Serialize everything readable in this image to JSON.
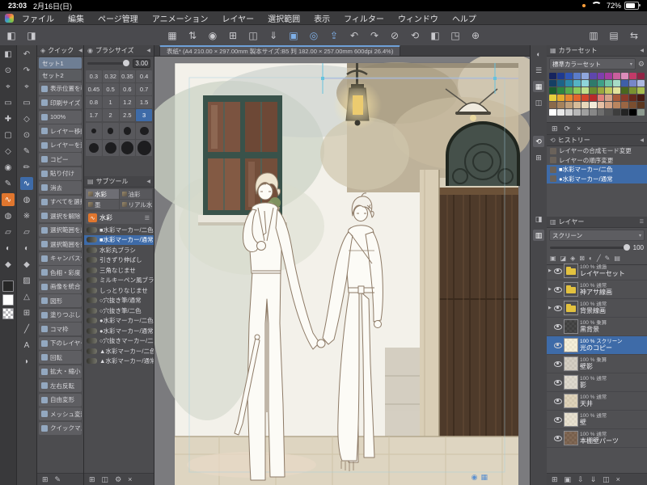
{
  "glyphs": {
    "collapse": "◀",
    "burger": "☰",
    "dropdown": "▾",
    "gear": "⚙"
  },
  "status_bar": {
    "time": "23:03",
    "date": "2月16日(日)",
    "battery_percent": "72%"
  },
  "menu_bar": {
    "items": [
      "ファイル",
      "編集",
      "ページ管理",
      "アニメーション",
      "レイヤー",
      "選択範囲",
      "表示",
      "フィルター",
      "ウィンドウ",
      "ヘルプ"
    ]
  },
  "toolbar": {
    "left_icons": [
      {
        "name": "tool-panel-toggle-icon",
        "glyph": "◧"
      },
      {
        "name": "quick-panel-toggle-icon",
        "glyph": "◨"
      }
    ],
    "center_icons": [
      {
        "name": "workspace-grid-icon",
        "glyph": "▦",
        "cls": ""
      },
      {
        "name": "panel-arrange-icon",
        "glyph": "⇅",
        "cls": ""
      },
      {
        "name": "clip-studio-logo-icon",
        "glyph": "◉",
        "cls": ""
      },
      {
        "name": "new-canvas-icon",
        "glyph": "⊞",
        "cls": ""
      },
      {
        "name": "page-manager-icon",
        "glyph": "◫",
        "cls": ""
      },
      {
        "name": "import-icon",
        "glyph": "⇓",
        "cls": ""
      },
      {
        "name": "photo-library-icon",
        "glyph": "▣",
        "cls": "accent"
      },
      {
        "name": "camera-icon",
        "glyph": "◎",
        "cls": "accent"
      },
      {
        "name": "share-icon",
        "glyph": "⇪",
        "cls": "accent"
      },
      {
        "name": "undo-icon",
        "glyph": "↶",
        "cls": ""
      },
      {
        "name": "redo-icon",
        "glyph": "↷",
        "cls": ""
      },
      {
        "name": "deselect-icon",
        "glyph": "⊘",
        "cls": ""
      },
      {
        "name": "rotate-canvas-icon",
        "glyph": "⟲",
        "cls": ""
      },
      {
        "name": "flip-canvas-icon",
        "glyph": "◧",
        "cls": ""
      },
      {
        "name": "fit-screen-icon",
        "glyph": "◳",
        "cls": ""
      },
      {
        "name": "zoom-in-icon",
        "glyph": "⊕",
        "cls": ""
      }
    ],
    "right_icons": [
      {
        "name": "color-panel-toggle-icon",
        "glyph": "▥"
      },
      {
        "name": "layer-panel-toggle-icon",
        "glyph": "▤"
      },
      {
        "name": "workspace-switch-icon",
        "glyph": "⇆"
      }
    ]
  },
  "document_tab": {
    "title": "表紙* (A4 210.00 × 297.00mm 製本サイズ:B5 判 182.00 × 257.00mm 600dpi 26.4%)"
  },
  "tool_strip_a": {
    "main_color": "#262626",
    "sub_color": "#ffffff",
    "items": [
      {
        "name": "collapse-tools-icon",
        "glyph": "◧",
        "state": ""
      },
      {
        "name": "zoom-tool",
        "glyph": "⊙",
        "state": ""
      },
      {
        "name": "move-canvas-tool",
        "glyph": "⌖",
        "state": ""
      },
      {
        "name": "operation-tool",
        "glyph": "▭",
        "state": ""
      },
      {
        "name": "layer-move-tool",
        "glyph": "✚",
        "state": ""
      },
      {
        "name": "selection-tool",
        "glyph": "▢",
        "state": ""
      },
      {
        "name": "auto-select-tool",
        "glyph": "◇",
        "state": ""
      },
      {
        "name": "eyedropper-tool",
        "glyph": "◉",
        "state": ""
      },
      {
        "name": "pen-tool",
        "glyph": "✎",
        "state": ""
      },
      {
        "name": "brush-tool",
        "glyph": "∿",
        "state": "selected"
      },
      {
        "name": "airbrush-tool",
        "glyph": "◍",
        "state": ""
      },
      {
        "name": "eraser-tool",
        "glyph": "▱",
        "state": ""
      },
      {
        "name": "blend-tool",
        "glyph": "◐",
        "state": ""
      },
      {
        "name": "fill-tool",
        "glyph": "◆",
        "state": ""
      }
    ]
  },
  "tool_strip_b": {
    "items": [
      {
        "name": "undo-tool-icon",
        "glyph": "↶",
        "state": ""
      },
      {
        "name": "redo-tool-icon",
        "glyph": "↷",
        "state": ""
      },
      {
        "name": "operation-sub-tool",
        "glyph": "⌖",
        "state": ""
      },
      {
        "name": "selection-sub-tool",
        "glyph": "▭",
        "state": ""
      },
      {
        "name": "auto-select-sub-tool",
        "glyph": "◇",
        "state": ""
      },
      {
        "name": "eyedropper-sub-tool",
        "glyph": "⊙",
        "state": ""
      },
      {
        "name": "pen-sub-tool",
        "glyph": "✎",
        "state": ""
      },
      {
        "name": "pencil-sub-tool",
        "glyph": "✏",
        "state": ""
      },
      {
        "name": "brush-sub-tool",
        "glyph": "∿",
        "state": "selected"
      },
      {
        "name": "airbrush-sub-tool",
        "glyph": "◍",
        "state": ""
      },
      {
        "name": "decoration-sub-tool",
        "glyph": "※",
        "state": ""
      },
      {
        "name": "eraser-sub-tool",
        "glyph": "▱",
        "state": ""
      },
      {
        "name": "blend-sub-tool",
        "glyph": "◐",
        "state": ""
      },
      {
        "name": "fill-sub-tool",
        "glyph": "◆",
        "state": ""
      },
      {
        "name": "gradient-sub-tool",
        "glyph": "▨",
        "state": ""
      },
      {
        "name": "figure-sub-tool",
        "glyph": "△",
        "state": ""
      },
      {
        "name": "frame-border-sub-tool",
        "glyph": "⊞",
        "state": ""
      },
      {
        "name": "ruler-sub-tool",
        "glyph": "╱",
        "state": ""
      },
      {
        "name": "text-sub-tool",
        "glyph": "A",
        "state": ""
      },
      {
        "name": "balloon-sub-tool",
        "glyph": "◗",
        "state": ""
      }
    ]
  },
  "quick_panel": {
    "title": "クイック",
    "icon_glyph": "◈",
    "sets": [
      {
        "label": "セット1",
        "state": "selected"
      },
      {
        "label": "セット2",
        "state": ""
      }
    ],
    "items": [
      "表示位置を移動",
      "印刷サイズ",
      "100%",
      "レイヤー移動",
      "レイヤーを選択",
      "コピー",
      "貼り付け",
      "消去",
      "すべてを選択",
      "選択を解除",
      "選択範囲を反転",
      "選択範囲を拡張",
      "キャンバスサイズ",
      "色相・彩度・明度",
      "画像を統合",
      "図形",
      "塗りつぶし",
      "コマ枠",
      "下のレイヤーに結合",
      "回転",
      "拡大・縮小",
      "左右反転",
      "自由変形",
      "メッシュ変形",
      "クイックマスク"
    ],
    "footer_icons": [
      {
        "name": "add-quick-item-icon",
        "glyph": "⊞"
      },
      {
        "name": "edit-quick-item-icon",
        "glyph": "✎"
      }
    ]
  },
  "brush_size_panel": {
    "title": "ブラシサイズ",
    "icon_glyph": "◉",
    "current_value": "3.00",
    "sizes": [
      {
        "label": "0.3",
        "state": ""
      },
      {
        "label": "0.32",
        "state": ""
      },
      {
        "label": "0.35",
        "state": ""
      },
      {
        "label": "0.4",
        "state": ""
      },
      {
        "label": "0.45",
        "state": ""
      },
      {
        "label": "0.5",
        "state": ""
      },
      {
        "label": "0.6",
        "state": ""
      },
      {
        "label": "0.7",
        "state": ""
      },
      {
        "label": "0.8",
        "state": ""
      },
      {
        "label": "1",
        "state": ""
      },
      {
        "label": "1.2",
        "state": ""
      },
      {
        "label": "1.5",
        "state": ""
      },
      {
        "label": "1.7",
        "state": ""
      },
      {
        "label": "2",
        "state": ""
      },
      {
        "label": "2.5",
        "state": ""
      },
      {
        "label": "3",
        "state": "selected"
      }
    ],
    "dot_count": 8
  },
  "subtool_panel": {
    "title": "サブツール",
    "icon_glyph": "▤",
    "tabs": [
      {
        "label": "水彩",
        "state": "selected"
      },
      {
        "label": "油彩",
        "state": ""
      },
      {
        "label": "墨",
        "state": ""
      },
      {
        "label": "リアル水彩",
        "state": ""
      }
    ],
    "current_tool_label": "水彩",
    "current_tool_icon_glyph": "∿",
    "items": [
      {
        "label": "■水彩マーカー/二色",
        "state": ""
      },
      {
        "label": "■水彩マーカー/通常",
        "state": "selected"
      },
      {
        "label": "水彩丸ブラシ",
        "state": ""
      },
      {
        "label": "引きずり伸ばし",
        "state": ""
      },
      {
        "label": "三角なじませ",
        "state": ""
      },
      {
        "label": "ミルキーペン風ブラシ",
        "state": ""
      },
      {
        "label": "しっとりなじませ",
        "state": ""
      },
      {
        "label": "○穴抜き筆/通常",
        "state": ""
      },
      {
        "label": "○穴抜き筆/二色",
        "state": ""
      },
      {
        "label": "●水彩マーカー/二色",
        "state": ""
      },
      {
        "label": "●水彩マーカー/通常",
        "state": ""
      },
      {
        "label": "○穴抜きマーカー/二色",
        "state": ""
      },
      {
        "label": "▲水彩マーカー/二色",
        "state": ""
      },
      {
        "label": "▲水彩マーカー/通常",
        "state": ""
      }
    ],
    "footer_icons": [
      {
        "name": "add-subtool-icon",
        "glyph": "⊞"
      },
      {
        "name": "duplicate-subtool-icon",
        "glyph": "◫"
      },
      {
        "name": "subtool-settings-icon",
        "glyph": "⚙"
      },
      {
        "name": "delete-subtool-icon",
        "glyph": "×"
      }
    ]
  },
  "color_set_panel": {
    "title": "カラーセット",
    "icon_glyph": "▦",
    "dropdown_value": "標準カラーセット",
    "selected_index": 60,
    "swatches": [
      "#16245e",
      "#1f3a8f",
      "#2f55b5",
      "#5b7cc9",
      "#8fa6dc",
      "#5e47ad",
      "#7e3fae",
      "#a63ca0",
      "#c95f9d",
      "#dd8cba",
      "#c23a68",
      "#8f2445",
      "#153f63",
      "#1d6387",
      "#2d8aa8",
      "#55b3c4",
      "#8fd4da",
      "#2f7a6b",
      "#3fa087",
      "#70c2a4",
      "#a7dcc6",
      "#3f5fa8",
      "#7787c9",
      "#adb8e0",
      "#1d5c2d",
      "#2f8540",
      "#58aa4e",
      "#8cc95e",
      "#bfdf8c",
      "#6a8c2f",
      "#9aa83f",
      "#c2c95e",
      "#e2e39c",
      "#49681f",
      "#7a9230",
      "#a9bd50",
      "#e5cf3d",
      "#e5ab2e",
      "#e5862e",
      "#e2652c",
      "#d2452c",
      "#b82a2a",
      "#e07f78",
      "#d4a188",
      "#a85a3a",
      "#8a3a2a",
      "#67291c",
      "#471b13",
      "#8a6a4a",
      "#a5825c",
      "#bf9f7a",
      "#d6bc99",
      "#e8d8ba",
      "#f2ead8",
      "#e5c0a5",
      "#d2a183",
      "#b9855f",
      "#9a6644",
      "#7a4e30",
      "#5a3720",
      "#ffffff",
      "#e8e8e8",
      "#d0d0d0",
      "#b8b8b8",
      "#9f9f9f",
      "#878787",
      "#6e6e6e",
      "#555555",
      "#3d3d3d",
      "#242424",
      "#000000",
      "#8d9a90"
    ],
    "footer_icons": [
      {
        "name": "add-color-icon",
        "glyph": "⊞"
      },
      {
        "name": "replace-color-icon",
        "glyph": "⟳"
      },
      {
        "name": "delete-color-icon",
        "glyph": "×"
      }
    ]
  },
  "history_panel": {
    "title": "ヒストリー",
    "icon_glyph": "⟲",
    "items": [
      {
        "label": "レイヤーの合成モード変更",
        "state": ""
      },
      {
        "label": "レイヤーの順序変更",
        "state": ""
      },
      {
        "label": "■水彩マーカー/二色",
        "state": "selected"
      },
      {
        "label": "●水彩マーカー/通常",
        "state": "selected"
      }
    ]
  },
  "layer_panel": {
    "title": "レイヤー",
    "icon_glyph": "▥",
    "blend_mode": "スクリーン",
    "opacity_value": "100",
    "tool_icons": [
      {
        "name": "layer-color-icon",
        "glyph": "▣"
      },
      {
        "name": "clip-to-below-icon",
        "glyph": "◪"
      },
      {
        "name": "lock-layer-icon",
        "glyph": "◈"
      },
      {
        "name": "lock-transparent-icon",
        "glyph": "⊠"
      },
      {
        "name": "mask-icon",
        "glyph": "◐"
      },
      {
        "name": "ruler-icon",
        "glyph": "╱"
      },
      {
        "name": "draft-layer-icon",
        "glyph": "✎"
      },
      {
        "name": "palette-icon",
        "glyph": "▤"
      }
    ],
    "layers": [
      {
        "blend": "100 % 通過",
        "name": "レイヤーセット",
        "thumb": "folder",
        "tint": "",
        "state": ""
      },
      {
        "blend": "100 % 通常",
        "name": "神アサ線画",
        "thumb": "folder",
        "tint": "",
        "state": ""
      },
      {
        "blend": "100 % 通常",
        "name": "背景線画",
        "thumb": "folder",
        "tint": "",
        "state": ""
      },
      {
        "blend": "100 % 乗算",
        "name": "黒背景",
        "thumb": "checker",
        "tint": "#2a2a2a",
        "state": ""
      },
      {
        "blend": "100 % スクリーン",
        "name": "光のコピー",
        "thumb": "checker",
        "tint": "#f2ecd2",
        "state": "selected"
      },
      {
        "blend": "100 % 乗算",
        "name": "壁影",
        "thumb": "checker",
        "tint": "#cdc6b8",
        "state": ""
      },
      {
        "blend": "100 % 通常",
        "name": "影",
        "thumb": "checker",
        "tint": "#d8d2c6",
        "state": ""
      },
      {
        "blend": "100 % 通常",
        "name": "天井",
        "thumb": "checker",
        "tint": "#d9cbae",
        "state": ""
      },
      {
        "blend": "100 % 通常",
        "name": "壁",
        "thumb": "checker",
        "tint": "#e4dcc8",
        "state": ""
      },
      {
        "blend": "100 % 通常",
        "name": "本棚壁パーツ",
        "thumb": "checker",
        "tint": "#6b4f38",
        "state": ""
      }
    ],
    "footer_icons": [
      {
        "name": "new-layer-icon",
        "glyph": "⊞"
      },
      {
        "name": "new-folder-icon",
        "glyph": "▣"
      },
      {
        "name": "transfer-down-icon",
        "glyph": "⇩"
      },
      {
        "name": "merge-down-icon",
        "glyph": "⇓"
      },
      {
        "name": "duplicate-layer-icon",
        "glyph": "◫"
      },
      {
        "name": "delete-layer-icon",
        "glyph": "×"
      }
    ]
  },
  "right_rail": {
    "icons": [
      {
        "name": "color-wheel-rail-icon",
        "glyph": "◐",
        "state": ""
      },
      {
        "name": "color-slider-rail-icon",
        "glyph": "☰",
        "state": ""
      },
      {
        "name": "color-set-rail-icon",
        "glyph": "▦",
        "state": "selected"
      },
      {
        "name": "color-mixing-rail-icon",
        "glyph": "◫",
        "state": ""
      },
      {
        "name": "history-rail-icon",
        "glyph": "⟲",
        "state": "selected"
      },
      {
        "name": "navigator-rail-icon",
        "glyph": "⊞",
        "state": ""
      },
      {
        "name": "layer-property-rail-icon",
        "glyph": "◨",
        "state": ""
      },
      {
        "name": "layer-rail-icon",
        "glyph": "▥",
        "state": "selected"
      }
    ]
  },
  "canvas": {
    "launcher_icons": [
      {
        "name": "selection-launcher-icon",
        "glyph": "◉"
      },
      {
        "name": "command-launcher-icon",
        "glyph": "▦"
      }
    ]
  }
}
